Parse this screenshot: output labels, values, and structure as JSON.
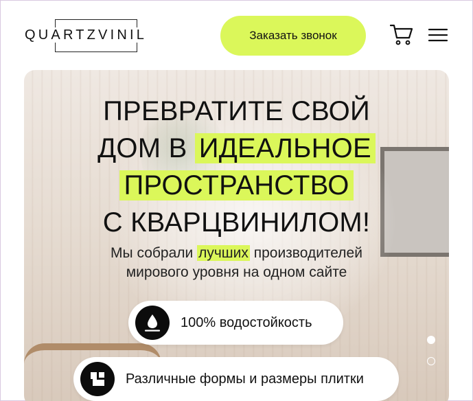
{
  "header": {
    "logo_text": "QUARTZVINIL",
    "call_button_label": "Заказать звонок",
    "cart_icon": "cart-icon",
    "menu_icon": "hamburger-menu-icon"
  },
  "hero": {
    "title_line1": "ПРЕВРАТИТЕ СВОЙ",
    "title_line2_plain": "ДОМ В",
    "title_line2_highlight": "ИДЕАЛЬНОЕ",
    "title_line3_highlight": "ПРОСТРАНСТВО",
    "title_line4": "С КВАРЦВИНИЛОМ!",
    "subtitle_before": "Мы собрали",
    "subtitle_highlight": "лучших",
    "subtitle_after": "производителей",
    "subtitle_line2": "мирового уровня на одном сайте",
    "features": [
      {
        "icon": "water-drop-icon",
        "label": "100% водостойкость"
      },
      {
        "icon": "tile-shapes-icon",
        "label": "Различные формы и размеры плитки"
      }
    ],
    "slider": {
      "total": 2,
      "active": 1
    }
  },
  "colors": {
    "accent": "#dbf75a",
    "text": "#111111",
    "pill_background": "#ffffff",
    "icon_background": "#0c0c0c"
  }
}
